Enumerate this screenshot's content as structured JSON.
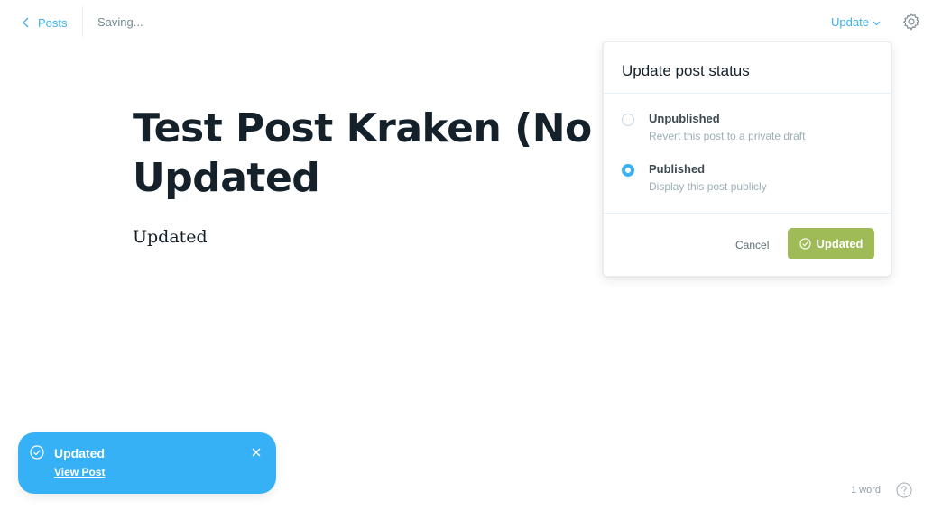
{
  "header": {
    "back_label": "Posts",
    "status_text": "Saving...",
    "update_label": "Update"
  },
  "icons": {
    "back": "chevron-left-icon",
    "dropdown": "chevron-down-icon",
    "settings": "gear-icon",
    "check": "check-circle-icon",
    "close": "close-icon",
    "help": "question-circle-icon"
  },
  "post": {
    "title_line1": "Test Post Kraken (No Co",
    "title_line2": "Updated",
    "body": "Updated"
  },
  "popover": {
    "title": "Update post status",
    "options": [
      {
        "label": "Unpublished",
        "description": "Revert this post to a private draft",
        "selected": false
      },
      {
        "label": "Published",
        "description": "Display this post publicly",
        "selected": true
      }
    ],
    "cancel_label": "Cancel",
    "confirm_label": "Updated"
  },
  "toast": {
    "title": "Updated",
    "link_label": "View Post"
  },
  "footer": {
    "word_count": "1 word"
  },
  "colors": {
    "accent": "#3eb0ef",
    "success": "#9fbb58",
    "toast": "#36b1f5",
    "text": "#15212a"
  }
}
